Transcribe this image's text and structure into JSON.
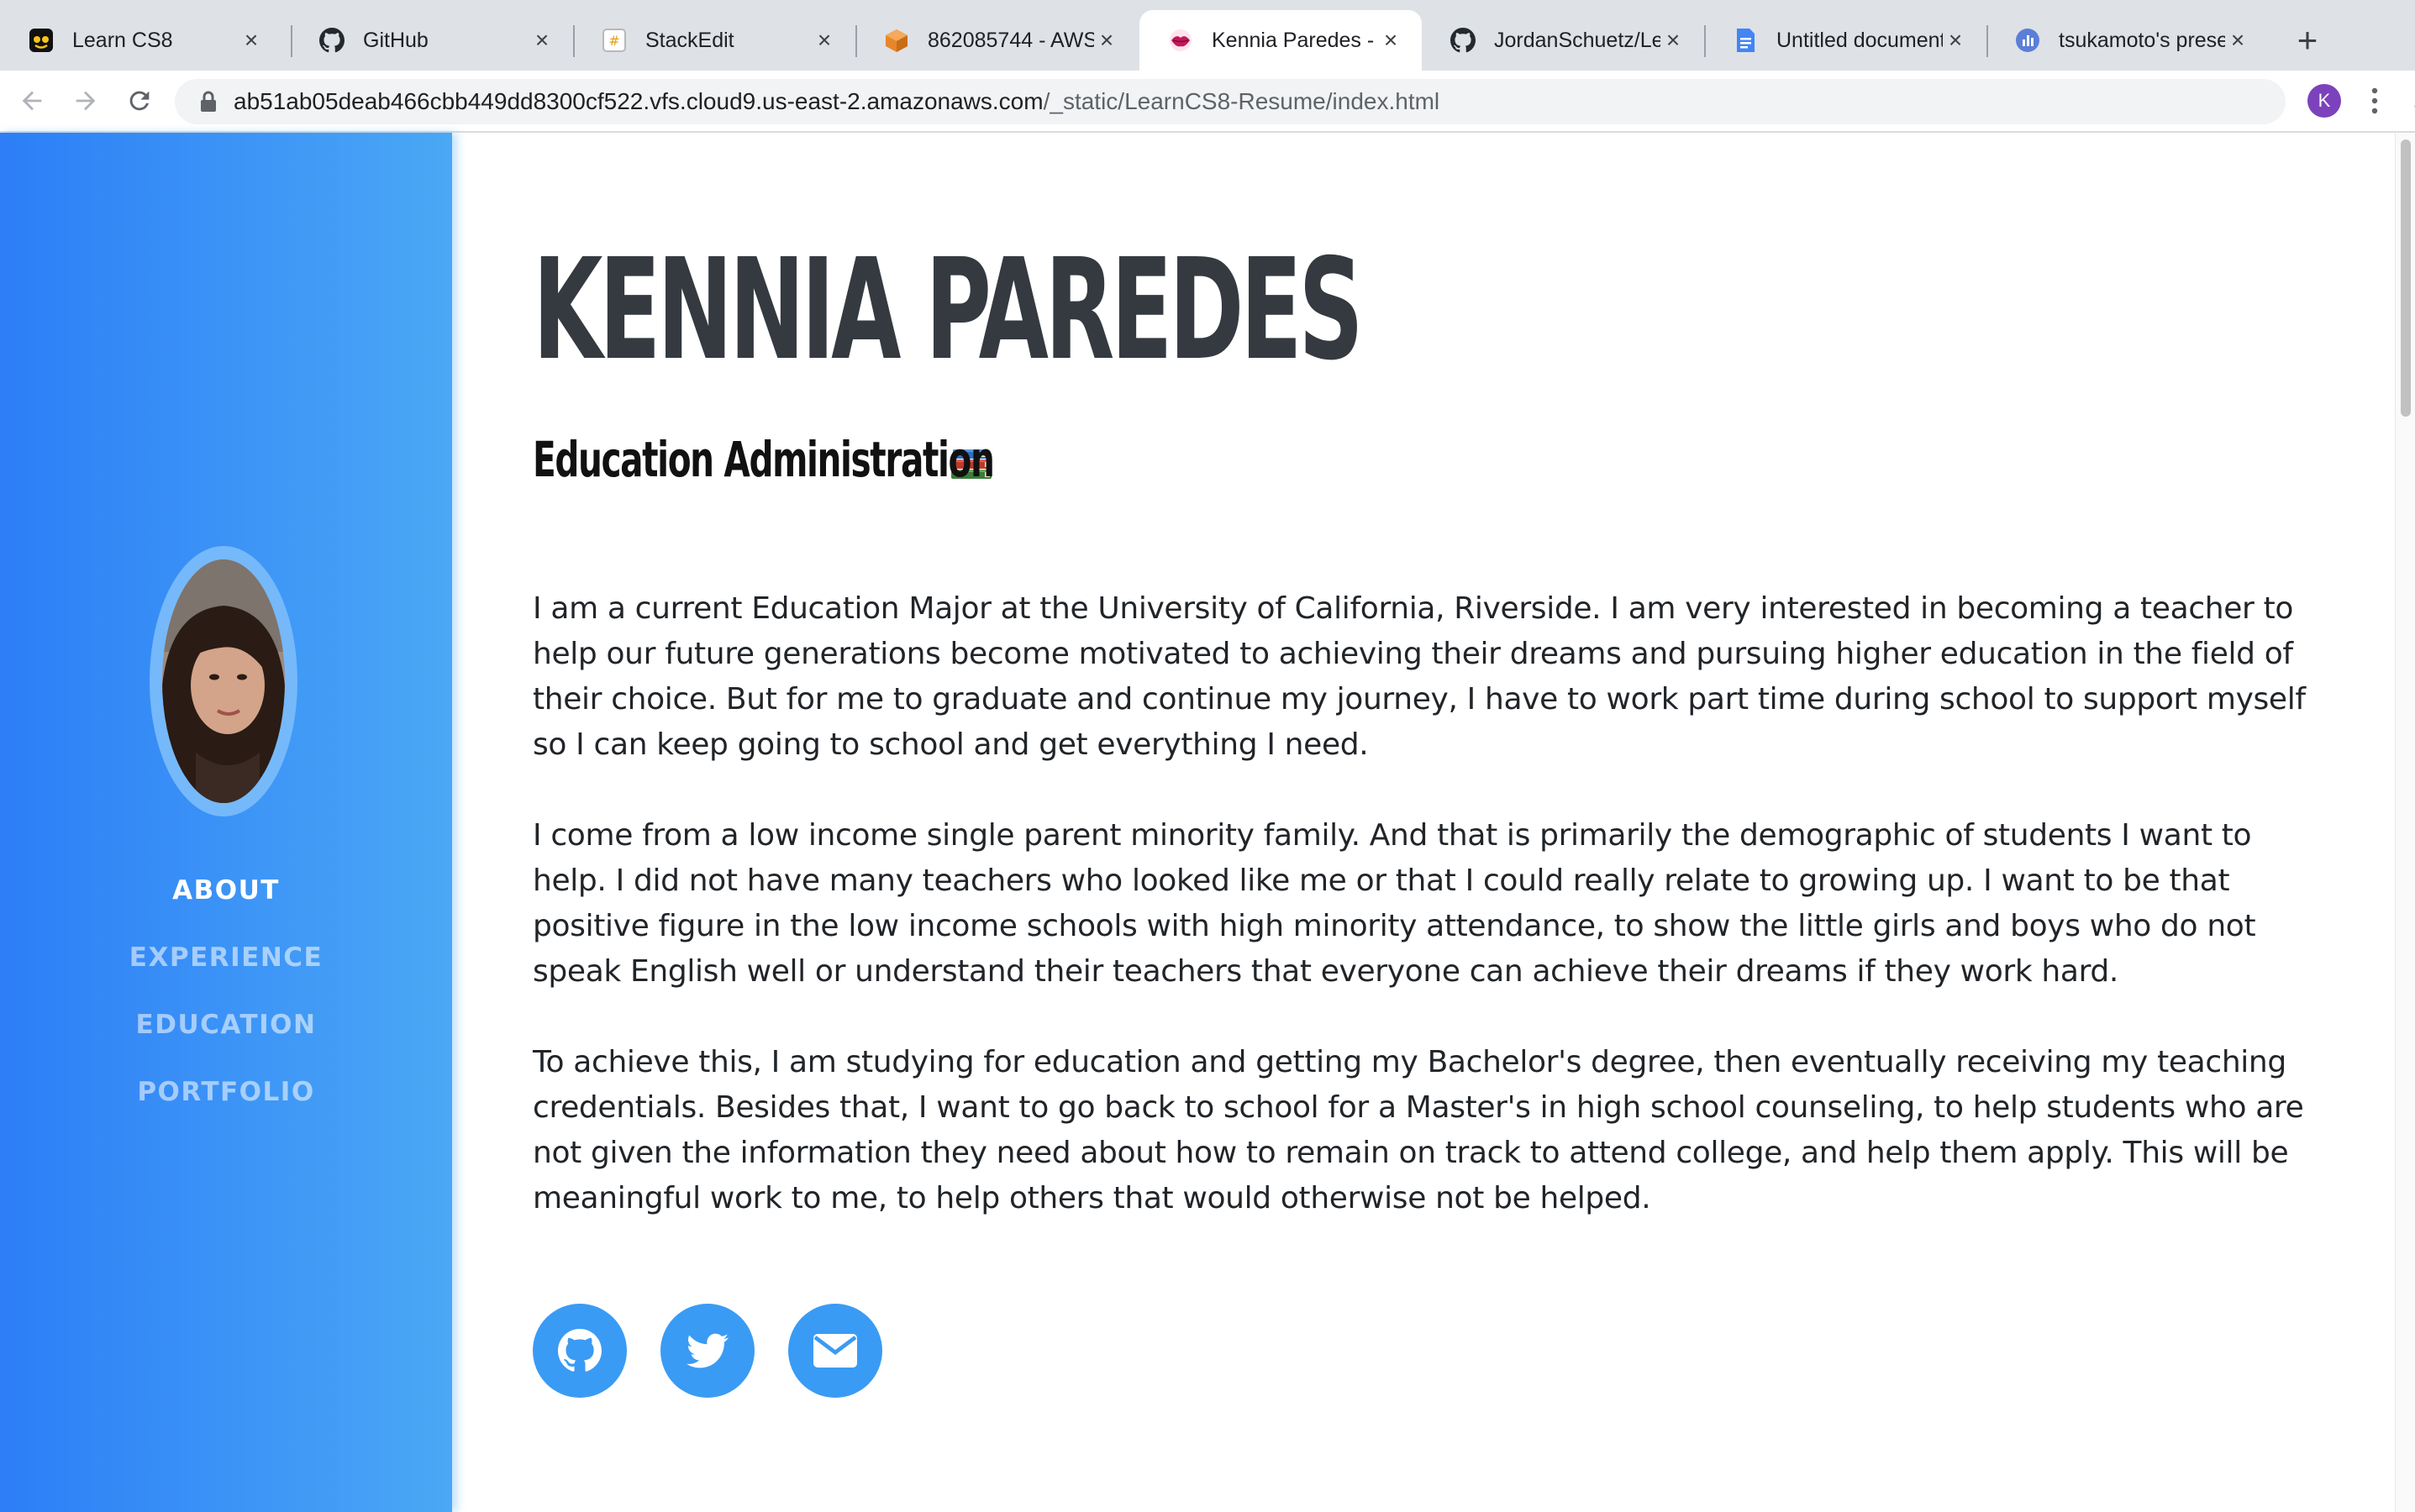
{
  "browser": {
    "tabs": [
      {
        "title": "Learn CS8",
        "icon": "learn-cs8-favicon",
        "active": false
      },
      {
        "title": "GitHub",
        "icon": "github-icon",
        "active": false
      },
      {
        "title": "StackEdit",
        "icon": "stackedit-icon",
        "active": false
      },
      {
        "title": "862085744 - AWS",
        "icon": "aws-cube-icon",
        "active": false
      },
      {
        "title": "Kennia Paredes - E",
        "icon": "lips-icon",
        "active": true
      },
      {
        "title": "JordanSchuetz/Le",
        "icon": "github-icon",
        "active": false
      },
      {
        "title": "Untitled document",
        "icon": "google-docs-icon",
        "active": false
      },
      {
        "title": "tsukamoto's prese",
        "icon": "presentation-icon",
        "active": false
      }
    ],
    "close_glyph": "×",
    "new_tab_glyph": "+",
    "url_host": "ab51ab05deab466cbb449dd8300cf522.vfs.cloud9.us-east-2.amazonaws.com",
    "url_path": "/_static/LearnCS8-Resume/index.html",
    "profile_initial": "K"
  },
  "sidebar": {
    "nav": [
      {
        "label": "ABOUT",
        "active": true
      },
      {
        "label": "EXPERIENCE",
        "active": false
      },
      {
        "label": "EDUCATION",
        "active": false
      },
      {
        "label": "PORTFOLIO",
        "active": false
      }
    ]
  },
  "main": {
    "name": "KENNIA PAREDES",
    "subtitle": "Education Administration",
    "subtitle_emoji": "books-emoji",
    "paragraphs": [
      "I am a current Education Major at the University of California, Riverside. I am very interested in becoming a teacher to help our future generations become motivated to achieving their dreams and pursuing higher education in the field of their choice. But for me to graduate and continue my journey, I have to work part time during school to support myself so I can keep going to school and get everything I need.",
      "I come from a low income single parent minority family. And that is primarily the demographic of students I want to help. I did not have many teachers who looked like me or that I could really relate to growing up. I want to be that positive figure in the low income schools with high minority attendance, to show the little girls and boys who do not speak English well or understand their teachers that everyone can achieve their dreams if they work hard.",
      "To achieve this, I am studying for education and getting my Bachelor's degree, then eventually receiving my teaching credentials. Besides that, I want to go back to school for a Master's in high school counseling, to help students who are not given the information they need about how to remain on track to attend college, and help them apply. This will be meaningful work to me, to help others that would otherwise not be helped."
    ],
    "social": [
      "github-icon",
      "twitter-icon",
      "envelope-icon"
    ]
  },
  "colors": {
    "sidebar_start": "#2d7ef7",
    "sidebar_end": "#4aa8f5",
    "social_bg": "#3a9bf4",
    "heading": "#343a40"
  }
}
